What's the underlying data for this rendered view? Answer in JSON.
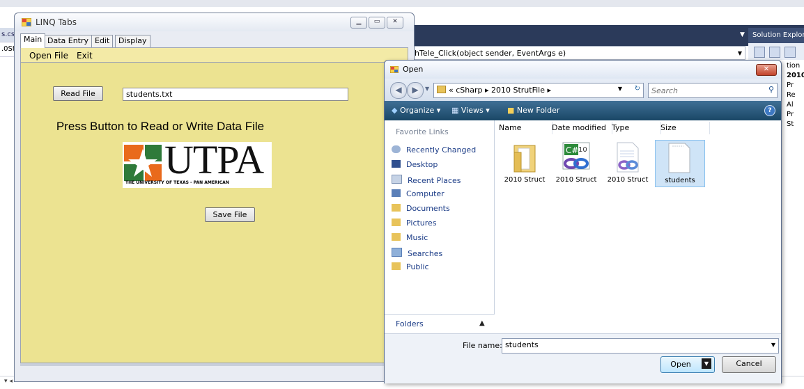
{
  "ide": {
    "left_files": [
      "s.cs",
      ".0St"
    ],
    "code_method": "chTele_Click(object sender, EventArgs e)",
    "solution_explorer_title": "Solution Explor",
    "tree": [
      "tion",
      "2010",
      "Pr",
      "Re",
      "Al",
      "Pr",
      "St"
    ]
  },
  "linq_window": {
    "title": "LINQ Tabs",
    "tabs": [
      "Main",
      "Data Entry",
      "Edit",
      "Display"
    ],
    "menu": [
      "Open File",
      "Exit"
    ],
    "read_button": "Read File",
    "file_value": "students.txt",
    "press_label": "Press Button to Read or Write Data File",
    "logo_word": "UTPA",
    "logo_subtitle": "THE UNIVERSITY OF TEXAS - PAN AMERICAN",
    "save_button": "Save File"
  },
  "open_dialog": {
    "title": "Open",
    "breadcrumb": "« cSharp ▸ 2010 StrutFile ▸",
    "search_placeholder": "Search",
    "toolbar": {
      "organize": "Organize",
      "views": "Views",
      "new_folder": "New Folder"
    },
    "favorites_header": "Favorite Links",
    "favorites": [
      {
        "label": "Recently Changed",
        "icon": "recent-icon"
      },
      {
        "label": "Desktop",
        "icon": "desktop-icon"
      },
      {
        "label": "Recent Places",
        "icon": "recent-places-icon"
      },
      {
        "label": "Computer",
        "icon": "computer-icon"
      },
      {
        "label": "Documents",
        "icon": "folder-icon"
      },
      {
        "label": "Pictures",
        "icon": "folder-icon"
      },
      {
        "label": "Music",
        "icon": "folder-icon"
      },
      {
        "label": "Searches",
        "icon": "search-folder-icon"
      },
      {
        "label": "Public",
        "icon": "folder-icon"
      }
    ],
    "folders_label": "Folders",
    "columns": [
      "Name",
      "Date modified",
      "Type",
      "Size"
    ],
    "files": [
      {
        "label": "2010 Struct",
        "icon": "folder-icon"
      },
      {
        "label": "2010 Struct",
        "icon": "csharp-project-icon"
      },
      {
        "label": "2010 Struct",
        "icon": "vs-solution-icon"
      },
      {
        "label": "students",
        "icon": "text-file-icon"
      }
    ],
    "file_name_label": "File name:",
    "file_name_value": "students",
    "open_button": "Open",
    "cancel_button": "Cancel"
  },
  "colors": {
    "form_body": "#ece391",
    "menu_bar": "#f3eaa6",
    "dialog_toolbar": "#1a4766",
    "ide_dark": "#2b3a5a",
    "link_blue": "#1a3b86"
  }
}
